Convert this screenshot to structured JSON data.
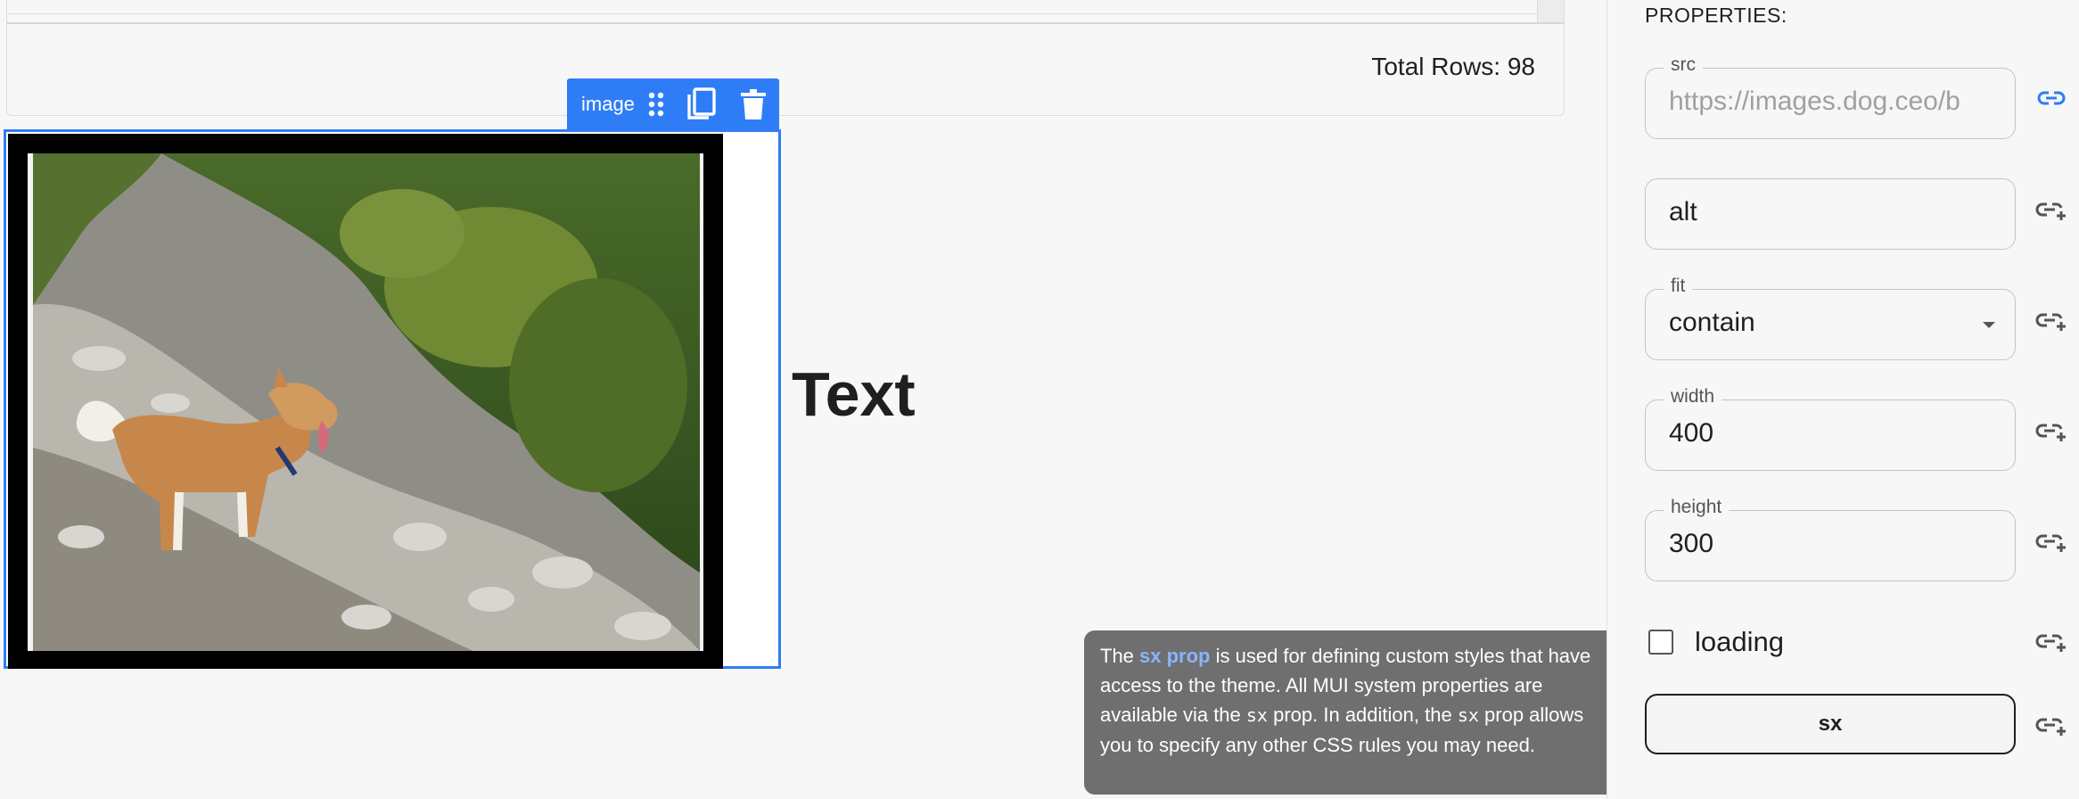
{
  "canvas": {
    "grid": {
      "total_rows_text": "Total Rows: 98"
    },
    "image_component": {
      "toolbar_label": "image",
      "icons": [
        "drag-handle-icon",
        "copy-icon",
        "delete-icon"
      ],
      "accent_color": "#2f7df6"
    },
    "text_component": {
      "text": "Text"
    },
    "tooltip": {
      "part1": "The ",
      "link": "sx prop",
      "part2": " is used for defining custom styles that have access to the theme. All MUI system properties are available via the ",
      "code1": "sx",
      "part3": " prop. In addition, the ",
      "code2": "sx",
      "part4": " prop allows you to specify any other CSS rules you may need."
    }
  },
  "panel": {
    "title": "PROPERTIES:",
    "fields": {
      "src": {
        "label": "src",
        "placeholder": "https://images.dog.ceo/b"
      },
      "alt": {
        "label": "",
        "value": "alt"
      },
      "fit": {
        "label": "fit",
        "value": "contain"
      },
      "width": {
        "label": "width",
        "value": "400"
      },
      "height": {
        "label": "height",
        "value": "300"
      }
    },
    "loading": {
      "label": "loading",
      "checked": false
    },
    "sx_button_label": "sx",
    "bound_color": "#2f7df6"
  }
}
